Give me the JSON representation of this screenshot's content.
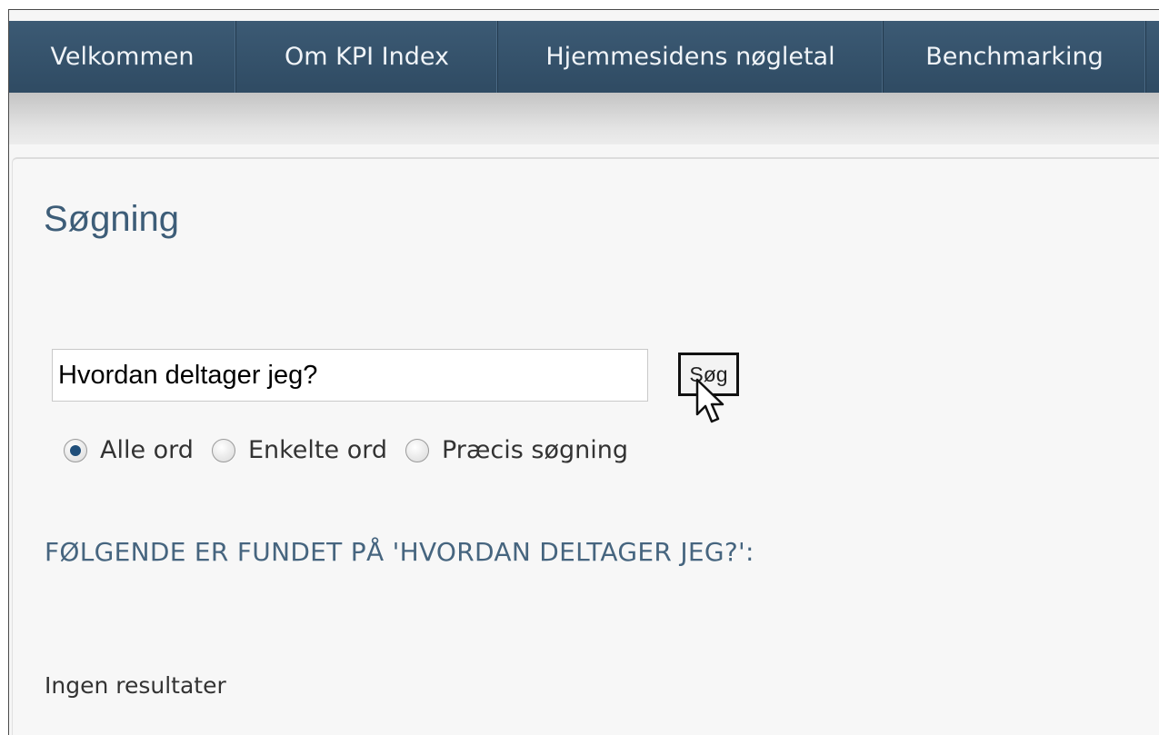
{
  "nav": {
    "items": [
      {
        "label": "Velkommen"
      },
      {
        "label": "Om KPI Index"
      },
      {
        "label": "Hjemmesidens nøgletal"
      },
      {
        "label": "Benchmarking"
      }
    ]
  },
  "search": {
    "title": "Søgning",
    "query": "Hvordan deltager jeg?",
    "button_label": "Søg",
    "options": [
      {
        "label": "Alle ord",
        "checked": true
      },
      {
        "label": "Enkelte ord",
        "checked": false
      },
      {
        "label": "Præcis søgning",
        "checked": false
      }
    ]
  },
  "results": {
    "heading": "FØLGENDE ER FUNDET PÅ 'HVORDAN DELTAGER JEG?':",
    "empty_text": "Ingen resultater"
  },
  "colors": {
    "nav_background": "#34516a",
    "title_color": "#3d5d78"
  }
}
